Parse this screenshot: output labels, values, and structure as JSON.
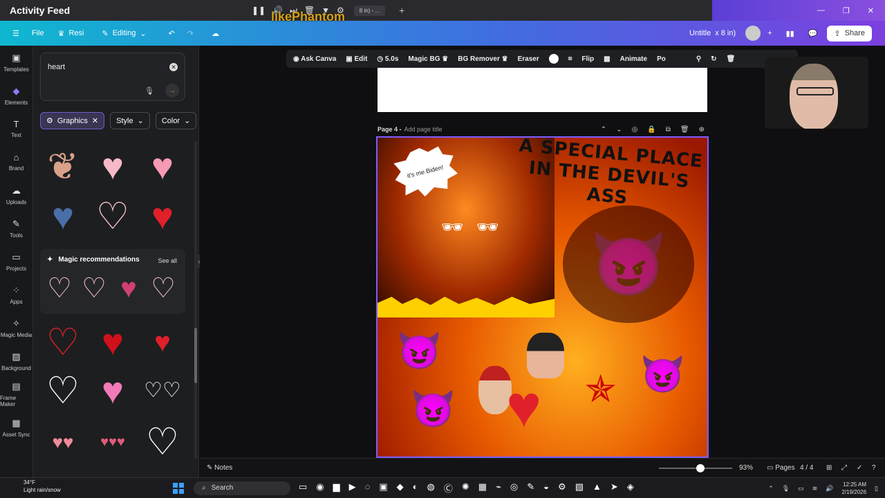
{
  "overlay": {
    "title": "Activity Feed",
    "tab_label": "8 in) - ...",
    "watermark": "likePhantom"
  },
  "topbar": {
    "file": "File",
    "resize": "Resi",
    "editing": "Editing",
    "doc_title": "Untitle",
    "doc_size": "x 8 in)",
    "share": "Share"
  },
  "rail": {
    "items": [
      {
        "label": "Templates",
        "icon": "template-icon"
      },
      {
        "label": "Elements",
        "icon": "elements-icon"
      },
      {
        "label": "Text",
        "icon": "text-icon"
      },
      {
        "label": "Brand",
        "icon": "brand-icon"
      },
      {
        "label": "Uploads",
        "icon": "uploads-icon"
      },
      {
        "label": "Tools",
        "icon": "tools-icon"
      },
      {
        "label": "Projects",
        "icon": "projects-icon"
      },
      {
        "label": "Apps",
        "icon": "apps-icon"
      },
      {
        "label": "Magic Media",
        "icon": "magic-media-icon"
      },
      {
        "label": "Background",
        "icon": "background-icon"
      },
      {
        "label": "Frame Maker",
        "icon": "frame-maker-icon"
      },
      {
        "label": "Asset Sync",
        "icon": "asset-sync-icon"
      }
    ]
  },
  "panel": {
    "search_value": "heart",
    "chips": {
      "graphics": "Graphics",
      "style": "Style",
      "color": "Color"
    },
    "magic_title": "Magic recommendations",
    "see_all": "See all"
  },
  "toolbar": {
    "ask": "Ask Canva",
    "edit": "Edit",
    "duration": "5.0s",
    "magic_bg": "Magic BG",
    "bg_remover": "BG Remover",
    "eraser": "Eraser",
    "flip": "Flip",
    "animate": "Animate",
    "position": "Po"
  },
  "canvas": {
    "page_label": "Page 4 -",
    "page_title_placeholder": "Add page title",
    "bubble_text": "it's me Biden!",
    "headline": "A SPECIAL PLACE IN THE DEVIL'S ASS"
  },
  "footer": {
    "notes": "Notes",
    "zoom": "93%",
    "pages": "Pages",
    "page_count": "4 / 4"
  },
  "taskbar": {
    "weather_temp": "34°F",
    "weather_desc": "Light rain/snow",
    "search": "Search",
    "time": "12:25 AM",
    "date": "2/19/2026"
  }
}
